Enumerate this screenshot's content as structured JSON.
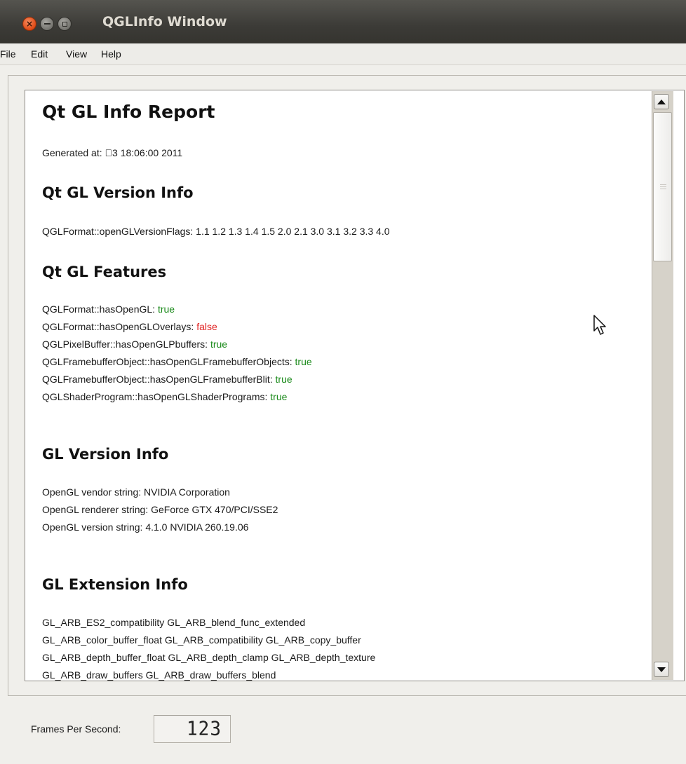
{
  "window": {
    "title": "QGLInfo Window",
    "buttons": {
      "close": "×",
      "minimize": "",
      "maximize": ""
    }
  },
  "menubar": {
    "items": [
      "File",
      "Edit",
      "View",
      "Help"
    ]
  },
  "report": {
    "title": "Qt GL Info Report",
    "generated_at": "Generated at: 3 18:06:00 2011",
    "qt_version_heading": "Qt GL Version Info",
    "version_flags": "QGLFormat::openGLVersionFlags: 1.1 1.2 1.3 1.4 1.5 2.0 2.1 3.0 3.1 3.2 3.3 4.0",
    "features_heading": "Qt GL Features",
    "features": [
      {
        "label": "QGLFormat::hasOpenGL: ",
        "value": "true"
      },
      {
        "label": "QGLFormat::hasOpenGLOverlays: ",
        "value": "false"
      },
      {
        "label": "QGLPixelBuffer::hasOpenGLPbuffers: ",
        "value": "true"
      },
      {
        "label": "QGLFramebufferObject::hasOpenGLFramebufferObjects: ",
        "value": "true"
      },
      {
        "label": "QGLFramebufferObject::hasOpenGLFramebufferBlit: ",
        "value": "true"
      },
      {
        "label": "QGLShaderProgram::hasOpenGLShaderPrograms: ",
        "value": "true"
      }
    ],
    "gl_version_heading": "GL Version Info",
    "gl_version_lines": [
      "OpenGL vendor string: NVIDIA Corporation",
      "OpenGL renderer string: GeForce GTX 470/PCI/SSE2",
      "OpenGL version string: 4.1.0 NVIDIA 260.19.06"
    ],
    "extension_heading": "GL Extension Info",
    "extension_lines": [
      "GL_ARB_ES2_compatibility GL_ARB_blend_func_extended",
      "GL_ARB_color_buffer_float GL_ARB_compatibility GL_ARB_copy_buffer",
      "GL_ARB_depth_buffer_float GL_ARB_depth_clamp GL_ARB_depth_texture",
      "GL_ARB_draw_buffers GL_ARB_draw_buffers_blend"
    ]
  },
  "status": {
    "fps_label": "Frames Per Second:",
    "fps_value": "123"
  },
  "colors": {
    "true": "#1a8a1a",
    "false": "#e02020",
    "titlebar": "#3c3b37",
    "close_button": "#df4a16"
  },
  "icons": [
    "close-icon",
    "minimize-icon",
    "maximize-icon",
    "scroll-up-arrow-icon",
    "scroll-down-arrow-icon",
    "mouse-pointer-icon"
  ]
}
